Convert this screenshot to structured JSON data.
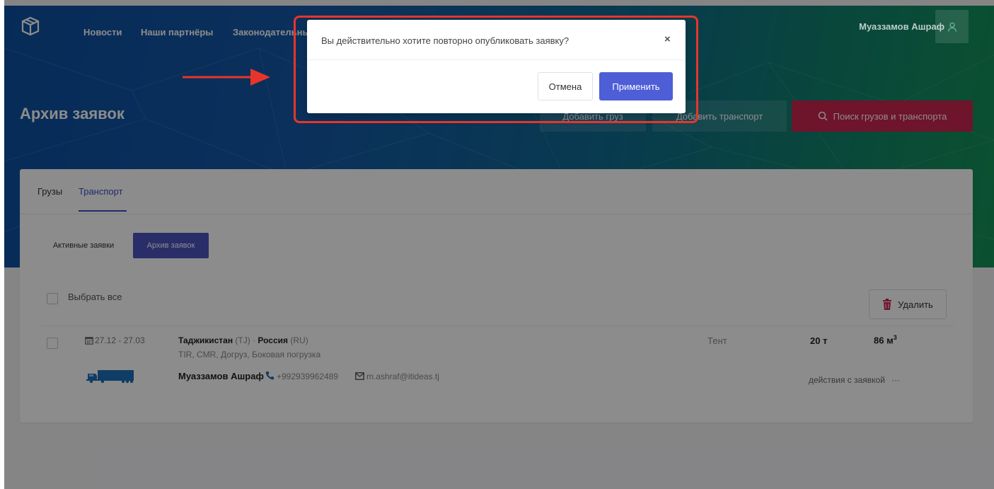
{
  "nav": {
    "items": [
      "Новости",
      "Наши партнёры",
      "Законодательные"
    ],
    "user_name": "Муаззамов Ашраф"
  },
  "header": {
    "title": "Архив заявок",
    "add_cargo": "Добавить груз",
    "add_transport": "Добавить транспорт",
    "search": "Поиск грузов и транспорта"
  },
  "tabs": [
    "Грузы",
    "Транспорт"
  ],
  "active_tab": "Транспорт",
  "subtabs": {
    "active": "Активные заявки",
    "archive": "Архив заявок"
  },
  "list": {
    "select_all": "Выбрать все",
    "delete": "Удалить",
    "rows": [
      {
        "dates": "27.12 - 27.03",
        "from_country": "Таджикистан",
        "from_code": "(TJ)",
        "separator": "·",
        "to_country": "Россия",
        "to_code": "(RU)",
        "docs": "TIR, CMR, Догруз, Боковая погрузка",
        "body_type": "Тент",
        "weight": "20 т",
        "volume": "86 м",
        "volume_sup": "3",
        "owner": "Муаззамов Ашраф",
        "phone": "+992939962489",
        "email": "m.ashraf@itideas.tj",
        "actions": "действия с заявкой",
        "more": "···"
      }
    ]
  },
  "modal": {
    "question": "Вы действительно хотите повторно опубликовать заявку?",
    "close": "×",
    "cancel": "Отмена",
    "apply": "Применить"
  },
  "colors": {
    "accent": "#4e5ed6",
    "search_button": "#c9254f",
    "highlight": "#e8352a"
  }
}
